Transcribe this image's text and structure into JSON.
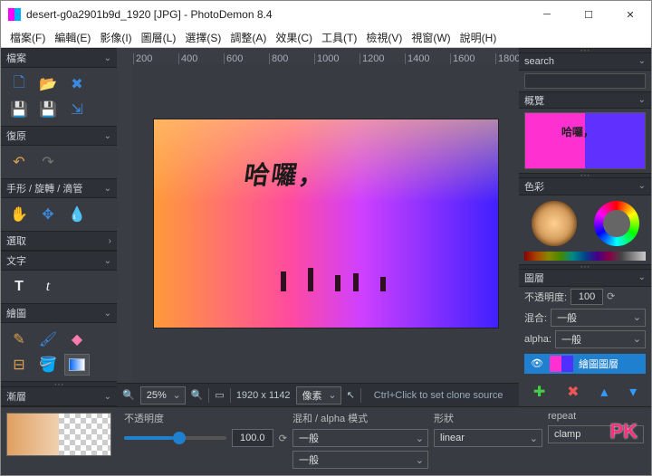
{
  "window": {
    "title": "desert-g0a2901b9d_1920 [JPG]  -  PhotoDemon 8.4"
  },
  "menu": [
    "檔案(F)",
    "編輯(E)",
    "影像(I)",
    "圖層(L)",
    "選擇(S)",
    "調整(A)",
    "效果(C)",
    "工具(T)",
    "檢視(V)",
    "視窗(W)",
    "說明(H)"
  ],
  "left": {
    "file_hdr": "檔案",
    "undo_hdr": "復原",
    "hand_hdr": "手形 / 旋轉 / 滴管",
    "select_hdr": "選取",
    "text_hdr": "文字",
    "paint_hdr": "繪圖",
    "grad_hdr": "漸層"
  },
  "canvas": {
    "overlay_text": "哈囉，"
  },
  "ruler": [
    "200",
    "400",
    "600",
    "800",
    "1000",
    "1200",
    "1400",
    "1600",
    "1800"
  ],
  "status": {
    "zoom": "25%",
    "dims": "1920 x 1142",
    "units": "像素",
    "hint": "Ctrl+Click to set clone source"
  },
  "right": {
    "search_hdr": "search",
    "overview_hdr": "概覽",
    "color_hdr": "色彩",
    "layers_hdr": "圖層",
    "opacity_lbl": "不透明度:",
    "opacity_val": "100",
    "blend_lbl": "混合:",
    "blend_val": "一般",
    "alpha_lbl": "alpha:",
    "alpha_val": "一般",
    "layer_name": "繪圖圖層",
    "preview_txt": "哈囉，"
  },
  "bottom": {
    "opacity_lbl": "不透明度",
    "opacity_val": "100.0",
    "blend_lbl": "混和 / alpha 模式",
    "blend_val1": "一般",
    "blend_val2": "一般",
    "shape_lbl": "形狀",
    "shape_val": "linear",
    "repeat_lbl": "repeat",
    "repeat_val": "clamp"
  },
  "pk": "PK"
}
